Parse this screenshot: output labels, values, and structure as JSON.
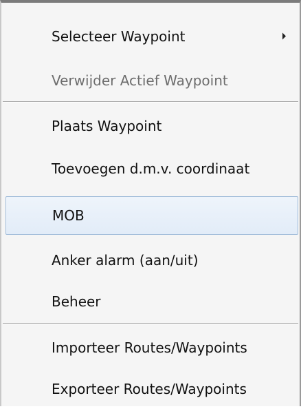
{
  "menu": {
    "items": [
      {
        "label": "Selecteer Waypoint",
        "state": "enabled",
        "submenu": true
      },
      {
        "label": "Verwijder Actief Waypoint",
        "state": "disabled"
      },
      {
        "label": "Plaats Waypoint",
        "state": "enabled"
      },
      {
        "label": "Toevoegen d.m.v. coordinaat",
        "state": "enabled"
      },
      {
        "label": "MOB",
        "state": "highlighted"
      },
      {
        "label": "Anker alarm (aan/uit)",
        "state": "enabled"
      },
      {
        "label": "Beheer",
        "state": "enabled"
      },
      {
        "label": "Importeer Routes/Waypoints",
        "state": "enabled"
      },
      {
        "label": "Exporteer Routes/Waypoints",
        "state": "enabled"
      }
    ],
    "submenu_icon": "chevron-right-icon"
  },
  "colors": {
    "background": "#f5f5f5",
    "text": "#111111",
    "disabled_text": "#6d6d6d",
    "highlight_fill": "#e6eef8",
    "highlight_border": "#9fbbd9",
    "separator": "#a9a9a9"
  }
}
